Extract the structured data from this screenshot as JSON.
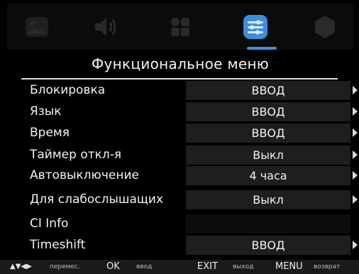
{
  "header": {
    "tabs": [
      {
        "icon": "picture-icon"
      },
      {
        "icon": "sound-icon"
      },
      {
        "icon": "channel-grid-icon"
      },
      {
        "icon": "function-settings-icon",
        "selected": true
      },
      {
        "icon": "lock-icon"
      }
    ],
    "accent_color": "#3c8ede"
  },
  "title": "Функциональное меню",
  "menu": {
    "items": [
      {
        "label": "Блокировка",
        "value": "ВВОД"
      },
      {
        "label": "Язык",
        "value": "ВВОД"
      },
      {
        "label": "Время",
        "value": "ВВОД"
      },
      {
        "label": "Таймер откл-я",
        "value": "Выкл"
      },
      {
        "label": "Автовыключение",
        "value": "4 часа"
      },
      {
        "label": "Для слабослышащих",
        "value": "Выкл"
      },
      {
        "label": "CI Info",
        "value": ""
      },
      {
        "label": "Timeshift",
        "value": "ВВОД"
      }
    ]
  },
  "footer": {
    "nav_key": "▲▼◀▶",
    "nav_label": "перемес.",
    "ok_key": "OK",
    "ok_label": "ввод",
    "exit_key": "EXIT",
    "exit_label": "выход",
    "menu_key": "MENU",
    "menu_label": "возврат"
  }
}
